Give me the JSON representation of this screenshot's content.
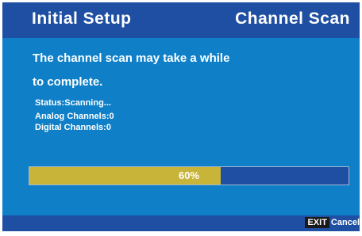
{
  "header": {
    "title": "Initial Setup",
    "screen_name": "Channel Scan"
  },
  "message": {
    "line1": "The channel scan may take a while",
    "line2": "to complete."
  },
  "status": {
    "scan_status": "Status:Scanning...",
    "analog": "Analog Channels:0",
    "digital": "Digital Channels:0"
  },
  "progress": {
    "percent": 60,
    "label": "60%"
  },
  "footer": {
    "exit_key": "EXIT",
    "exit_action": "Cancel"
  },
  "colors": {
    "background": "#0f80c8",
    "bars": "#1f4fa2",
    "progress_fill": "#c9b43a",
    "text": "#ffffff"
  }
}
